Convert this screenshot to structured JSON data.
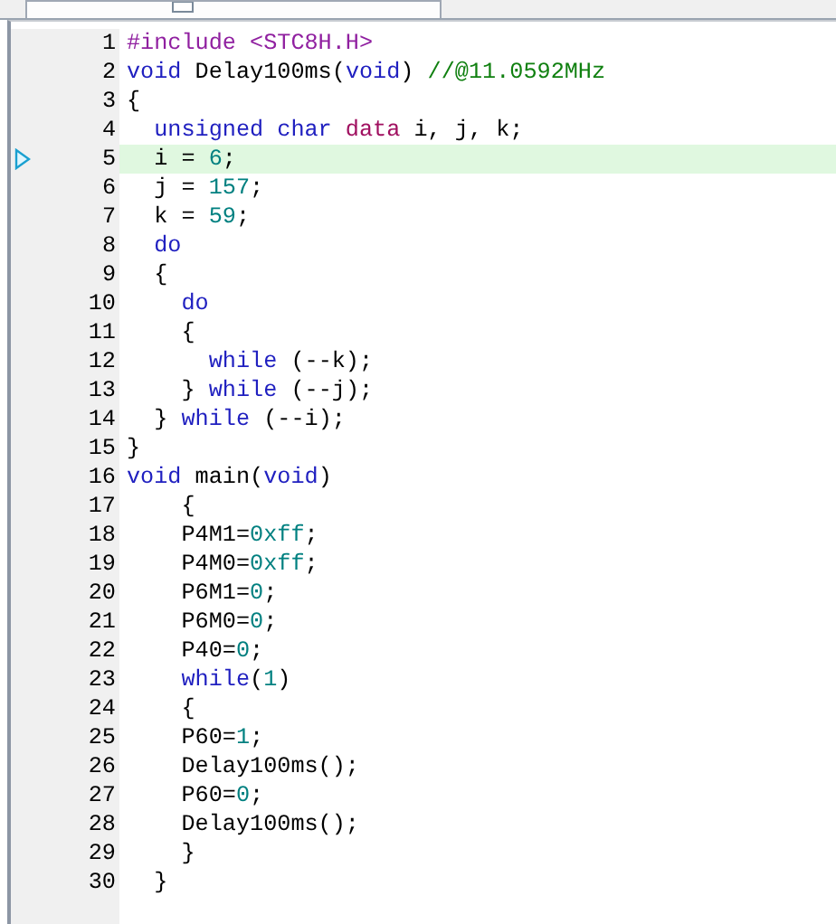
{
  "editor": {
    "lines": [
      {
        "number": "1",
        "current": false,
        "tokens": [
          {
            "kind": "preproc",
            "text": "#include <STC8H.H>"
          }
        ]
      },
      {
        "number": "2",
        "current": false,
        "tokens": [
          {
            "kind": "keyword",
            "text": "void"
          },
          {
            "kind": "plain",
            "text": " Delay100ms("
          },
          {
            "kind": "keyword",
            "text": "void"
          },
          {
            "kind": "plain",
            "text": ") "
          },
          {
            "kind": "comment",
            "text": "//@11.0592MHz"
          }
        ]
      },
      {
        "number": "3",
        "current": false,
        "tokens": [
          {
            "kind": "plain",
            "text": "{"
          }
        ]
      },
      {
        "number": "4",
        "current": false,
        "tokens": [
          {
            "kind": "keyword",
            "text": "  unsigned char"
          },
          {
            "kind": "storage",
            "text": " data"
          },
          {
            "kind": "plain",
            "text": " i, j, k;"
          }
        ]
      },
      {
        "number": "5",
        "current": true,
        "tokens": [
          {
            "kind": "plain",
            "text": "  i = "
          },
          {
            "kind": "number",
            "text": "6"
          },
          {
            "kind": "plain",
            "text": ";"
          }
        ]
      },
      {
        "number": "6",
        "current": false,
        "tokens": [
          {
            "kind": "plain",
            "text": "  j = "
          },
          {
            "kind": "number",
            "text": "157"
          },
          {
            "kind": "plain",
            "text": ";"
          }
        ]
      },
      {
        "number": "7",
        "current": false,
        "tokens": [
          {
            "kind": "plain",
            "text": "  k = "
          },
          {
            "kind": "number",
            "text": "59"
          },
          {
            "kind": "plain",
            "text": ";"
          }
        ]
      },
      {
        "number": "8",
        "current": false,
        "tokens": [
          {
            "kind": "keyword",
            "text": "  do"
          }
        ]
      },
      {
        "number": "9",
        "current": false,
        "tokens": [
          {
            "kind": "plain",
            "text": "  {"
          }
        ]
      },
      {
        "number": "10",
        "current": false,
        "tokens": [
          {
            "kind": "keyword",
            "text": "    do"
          }
        ]
      },
      {
        "number": "11",
        "current": false,
        "tokens": [
          {
            "kind": "plain",
            "text": "    {"
          }
        ]
      },
      {
        "number": "12",
        "current": false,
        "tokens": [
          {
            "kind": "keyword",
            "text": "      while"
          },
          {
            "kind": "plain",
            "text": " (--k);"
          }
        ]
      },
      {
        "number": "13",
        "current": false,
        "tokens": [
          {
            "kind": "plain",
            "text": "    } "
          },
          {
            "kind": "keyword",
            "text": "while"
          },
          {
            "kind": "plain",
            "text": " (--j);"
          }
        ]
      },
      {
        "number": "14",
        "current": false,
        "tokens": [
          {
            "kind": "plain",
            "text": "  } "
          },
          {
            "kind": "keyword",
            "text": "while"
          },
          {
            "kind": "plain",
            "text": " (--i);"
          }
        ]
      },
      {
        "number": "15",
        "current": false,
        "tokens": [
          {
            "kind": "plain",
            "text": "}"
          }
        ]
      },
      {
        "number": "16",
        "current": false,
        "tokens": [
          {
            "kind": "keyword",
            "text": "void"
          },
          {
            "kind": "plain",
            "text": " main("
          },
          {
            "kind": "keyword",
            "text": "void"
          },
          {
            "kind": "plain",
            "text": ")"
          }
        ]
      },
      {
        "number": "17",
        "current": false,
        "tokens": [
          {
            "kind": "plain",
            "text": "    {"
          }
        ]
      },
      {
        "number": "18",
        "current": false,
        "tokens": [
          {
            "kind": "plain",
            "text": "    P4M1="
          },
          {
            "kind": "number",
            "text": "0xff"
          },
          {
            "kind": "plain",
            "text": ";"
          }
        ]
      },
      {
        "number": "19",
        "current": false,
        "tokens": [
          {
            "kind": "plain",
            "text": "    P4M0="
          },
          {
            "kind": "number",
            "text": "0xff"
          },
          {
            "kind": "plain",
            "text": ";"
          }
        ]
      },
      {
        "number": "20",
        "current": false,
        "tokens": [
          {
            "kind": "plain",
            "text": "    P6M1="
          },
          {
            "kind": "number",
            "text": "0"
          },
          {
            "kind": "plain",
            "text": ";"
          }
        ]
      },
      {
        "number": "21",
        "current": false,
        "tokens": [
          {
            "kind": "plain",
            "text": "    P6M0="
          },
          {
            "kind": "number",
            "text": "0"
          },
          {
            "kind": "plain",
            "text": ";"
          }
        ]
      },
      {
        "number": "22",
        "current": false,
        "tokens": [
          {
            "kind": "plain",
            "text": "    P40="
          },
          {
            "kind": "number",
            "text": "0"
          },
          {
            "kind": "plain",
            "text": ";"
          }
        ]
      },
      {
        "number": "23",
        "current": false,
        "tokens": [
          {
            "kind": "keyword",
            "text": "    while"
          },
          {
            "kind": "plain",
            "text": "("
          },
          {
            "kind": "number",
            "text": "1"
          },
          {
            "kind": "plain",
            "text": ")"
          }
        ]
      },
      {
        "number": "24",
        "current": false,
        "tokens": [
          {
            "kind": "plain",
            "text": "    {"
          }
        ]
      },
      {
        "number": "25",
        "current": false,
        "tokens": [
          {
            "kind": "plain",
            "text": "    P60="
          },
          {
            "kind": "number",
            "text": "1"
          },
          {
            "kind": "plain",
            "text": ";"
          }
        ]
      },
      {
        "number": "26",
        "current": false,
        "tokens": [
          {
            "kind": "plain",
            "text": "    Delay100ms();"
          }
        ]
      },
      {
        "number": "27",
        "current": false,
        "tokens": [
          {
            "kind": "plain",
            "text": "    P60="
          },
          {
            "kind": "number",
            "text": "0"
          },
          {
            "kind": "plain",
            "text": ";"
          }
        ]
      },
      {
        "number": "28",
        "current": false,
        "tokens": [
          {
            "kind": "plain",
            "text": "    Delay100ms();"
          }
        ]
      },
      {
        "number": "29",
        "current": false,
        "tokens": [
          {
            "kind": "plain",
            "text": "    }"
          }
        ]
      },
      {
        "number": "30",
        "current": false,
        "tokens": [
          {
            "kind": "plain",
            "text": "  }"
          }
        ]
      }
    ]
  }
}
